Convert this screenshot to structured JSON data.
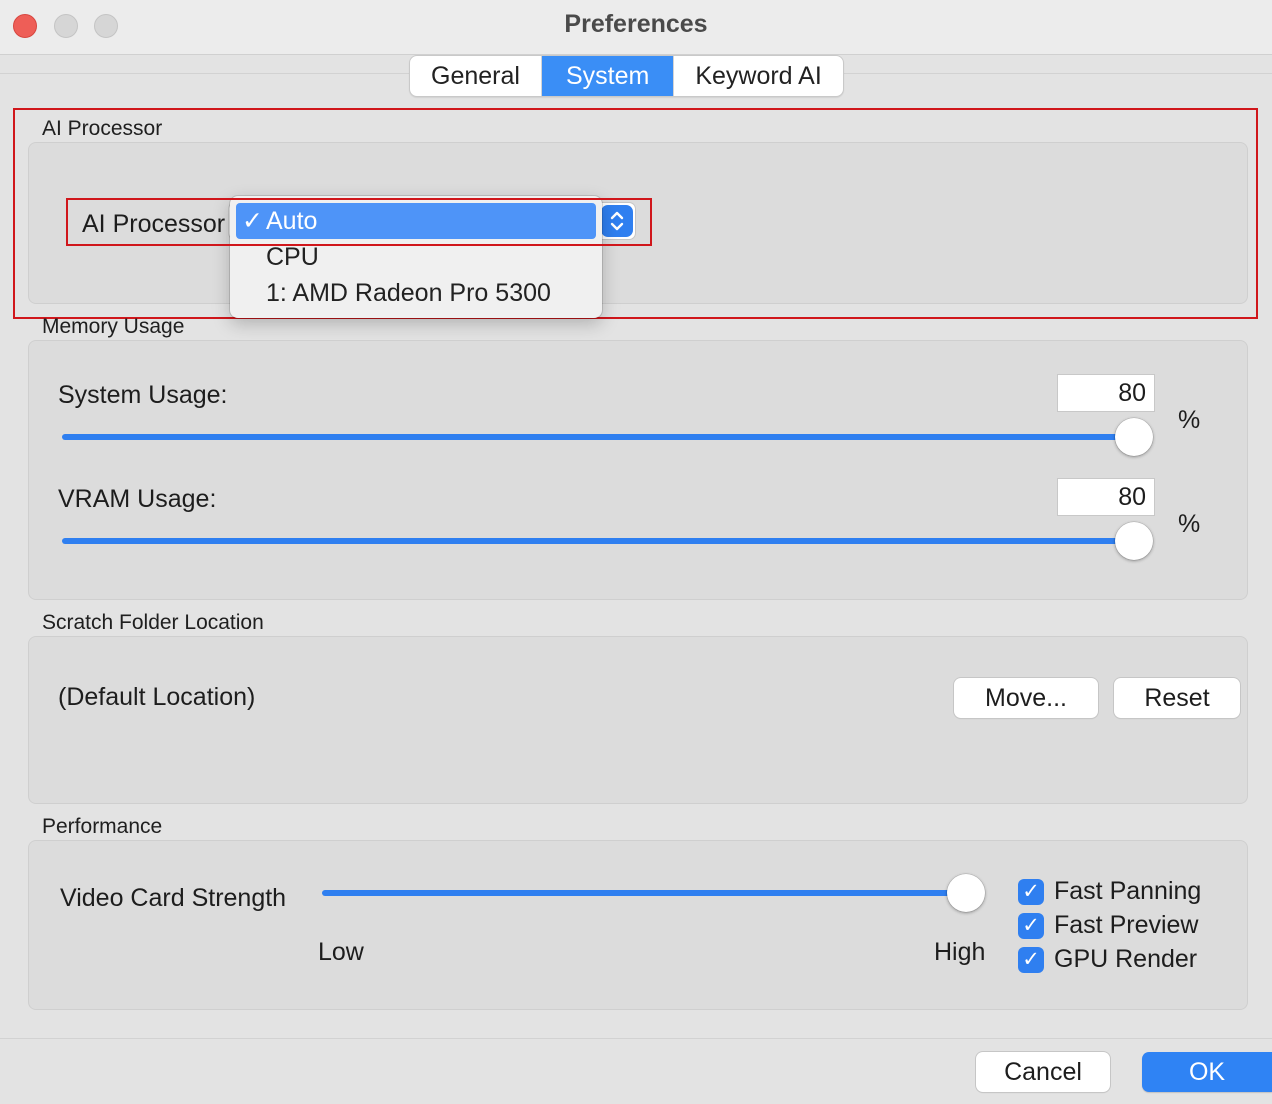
{
  "window": {
    "title": "Preferences"
  },
  "tabs": [
    {
      "label": "General",
      "active": false
    },
    {
      "label": "System",
      "active": true
    },
    {
      "label": "Keyword AI",
      "active": false
    }
  ],
  "ai_processor": {
    "group_label": "AI Processor",
    "field_label": "AI Processor",
    "selected": "Auto",
    "check_glyph": "✓",
    "options": [
      "Auto",
      "CPU",
      "1: AMD Radeon Pro 5300"
    ]
  },
  "memory": {
    "group_label": "Memory Usage",
    "system_label": "System Usage:",
    "system_value": "80",
    "vram_label": "VRAM Usage:",
    "vram_value": "80",
    "unit": "%"
  },
  "scratch": {
    "group_label": "Scratch Folder Location",
    "location": "(Default Location)",
    "move_label": "Move...",
    "reset_label": "Reset"
  },
  "performance": {
    "group_label": "Performance",
    "strength_label": "Video Card Strength",
    "low_label": "Low",
    "high_label": "High",
    "strength_level": 1.0,
    "options": [
      {
        "label": "Fast Panning",
        "checked": true
      },
      {
        "label": "Fast Preview",
        "checked": true
      },
      {
        "label": "GPU Render",
        "checked": true
      }
    ]
  },
  "footer": {
    "cancel_label": "Cancel",
    "ok_label": "OK"
  },
  "colors": {
    "accent": "#2f7ff0",
    "highlight": "#d0161b"
  }
}
